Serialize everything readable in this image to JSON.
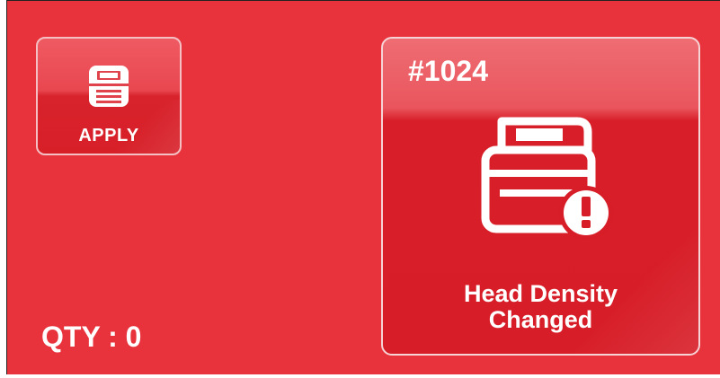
{
  "apply_button": {
    "label": "APPLY",
    "icon": "printer-icon"
  },
  "quantity": {
    "text": "QTY : 0"
  },
  "status_card": {
    "job_number": "#1024",
    "icon": "printer-warning-icon",
    "message_line1": "Head Density",
    "message_line2": "Changed"
  },
  "colors": {
    "background": "#e8333d",
    "card": "#d71d27",
    "text": "#ffffff"
  }
}
